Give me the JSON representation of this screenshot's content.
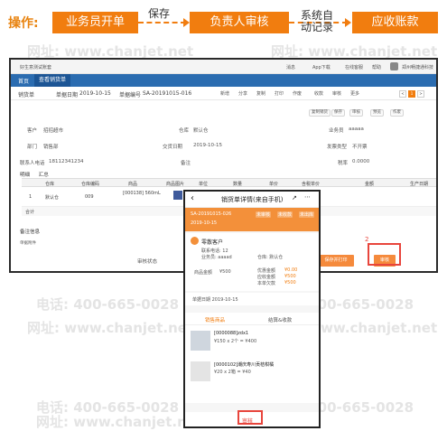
{
  "flow": {
    "label": "操作:",
    "steps": [
      "业务员开单",
      "负责人审核",
      "应收账款"
    ],
    "notes": [
      "保存",
      "系统自\n动记录"
    ]
  },
  "watermark": {
    "phone_lines": [
      "电话: 400-665-0028",
      "电话: 400-665-0028",
      "电话: 400-665-0028",
      "电话: 400-665-0028",
      "电话: 400-665-0028",
      "电话: 400-665-0028"
    ],
    "site_lines": [
      "网址: www.chanjet.net",
      "网址: www.chanjet.net",
      "网址: www.chanjet.net",
      "网址: www.chanjet.net",
      "网址: www.chanjet.net",
      "网址: www.chanjet.net",
      "网址: www.chanjet.net"
    ]
  },
  "desktop": {
    "topbar": {
      "left": "好生意测试账套",
      "right": [
        "消息",
        "App下载",
        "在线客服",
        "帮助",
        "郑州畅捷通科技"
      ]
    },
    "nav": [
      "首页",
      "查看销货单"
    ],
    "bar": {
      "title": "销货单",
      "date_label": "单据日期",
      "date": "2019-10-15",
      "code_label": "单据编号",
      "code": "SA-20191015-016"
    },
    "toolbar": [
      "新增",
      "分享",
      "复制",
      "打印",
      "作废",
      "收款",
      "审核",
      "更多"
    ],
    "pager": [
      "<",
      "1",
      ">"
    ],
    "subtools": [
      "复制销货",
      "保存",
      "审核",
      "预览",
      "作废"
    ],
    "fields": {
      "customer_label": "客户",
      "customer": "招招超市",
      "warehouse_label": "仓库",
      "warehouse": "默认仓",
      "dept_label": "部门",
      "dept": "销售部",
      "salesman_label": "业务员",
      "salesman": "aaaaa",
      "deliver_label": "交货日期",
      "deliver": "2019-10-15",
      "invoice_label": "发票类型",
      "invoice": "不开票",
      "contact_label": "联系人电话",
      "contact": "18112341234",
      "note_label": "备注",
      "rate_label": "税率",
      "rate": "0.0000"
    },
    "tabs": [
      "明细",
      "汇总"
    ],
    "table": {
      "headers": [
        "",
        "仓库",
        "仓库编码",
        "商品",
        "商品图片",
        "单位",
        "数量",
        "单价",
        "含税单价",
        "金额",
        "生产日期"
      ],
      "row": {
        "no": "1",
        "warehouse": "默认仓",
        "code": "009",
        "product": "[000138] 560mL",
        "unit": "瓶",
        "qty": "1",
        "price": "450"
      },
      "total_label": "合计"
    },
    "remark_label": "备注信息",
    "attach_label": "单据附件",
    "status_label": "审核状态",
    "buttons": {
      "print": "保存并打印",
      "audit": "审核"
    },
    "step_no": "2"
  },
  "phone": {
    "title": "销货单详情(来自手机)",
    "code": "SA-20191015-026",
    "badges": [
      "未审核",
      "未收款",
      "未出库"
    ],
    "date": "2019-10-15",
    "customer": "零散客户",
    "customer_fields": [
      "联系电话: 12",
      "业务员: aaaad",
      "仓库: 默认仓"
    ],
    "amount_label": "商品金额",
    "amount": "¥500",
    "summary": [
      {
        "label": "优惠金额",
        "value": "¥0.00"
      },
      {
        "label": "应收金额",
        "value": "¥500"
      },
      {
        "label": "本单欠款",
        "value": "¥500"
      }
    ],
    "bill_date": "单据日期  2019-10-15",
    "tabs": [
      "销售商品",
      "结算&收款"
    ],
    "products": [
      {
        "name": "[0000088]zdx1",
        "price": "¥150 x 2个 = ¥400"
      },
      {
        "name": "[0000102]潮庆寿川贡桔柑橘",
        "price": "¥20 x 2箱 = ¥40"
      }
    ],
    "audit_label": "审核"
  },
  "colors": {
    "accent": "#f17d0f",
    "nav": "#2b6cb0",
    "highlight": "#e8453c"
  }
}
